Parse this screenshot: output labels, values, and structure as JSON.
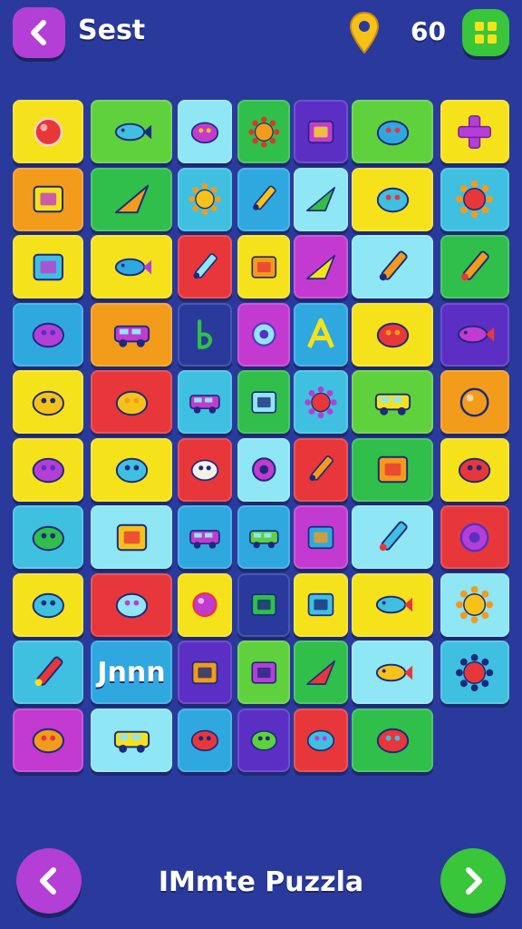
{
  "header": {
    "title": "Sest",
    "score": "60",
    "back_icon": "chevron-left-icon",
    "coin_icon": "location-pin-icon",
    "grid_icon": "grid-icon"
  },
  "footer": {
    "title": "IMmte Puzzla",
    "prev_icon": "chevron-left-icon",
    "next_icon": "chevron-right-icon"
  },
  "colors": {
    "background": "#2a3a9c",
    "purple": "#b43fd6",
    "green": "#39c63a",
    "yellow": "#f6e21a"
  },
  "tiles": [
    {
      "icon": "red-ball-icon",
      "bg": "#f6e21a",
      "c1": "#e8373a",
      "c2": "#ffd2d2"
    },
    {
      "icon": "fish-icon",
      "bg": "#5fd13c",
      "c1": "#3fc0e0",
      "c2": "#1b2a7c"
    },
    {
      "icon": "burger-icon",
      "bg": "#8fe6f5",
      "c1": "#c33ad0",
      "c2": "#f6c21a"
    },
    {
      "icon": "gear-icon",
      "bg": "#2fbf4a",
      "c1": "#f39b1a",
      "c2": "#d83a2a"
    },
    {
      "icon": "robot-icon",
      "bg": "#5b2fc4",
      "c1": "#c33ad0",
      "c2": "#f6e21a"
    },
    {
      "icon": "toy-blocks-icon",
      "bg": "#5fd13c",
      "c1": "#2fa8e0",
      "c2": "#e8373a"
    },
    {
      "icon": "plus-icon",
      "bg": "#f6e21a",
      "c1": "#b43fd6",
      "c2": "#7a1fa0"
    },
    {
      "icon": "bucket-icon",
      "bg": "#f39b1a",
      "c1": "#f6e21a",
      "c2": "#c33ad0"
    },
    {
      "icon": "triangle-ruler-icon",
      "bg": "#2fbf4a",
      "c1": "#f39b1a",
      "c2": "#1b2a7c"
    },
    {
      "icon": "sun-icon",
      "bg": "#3fc0e0",
      "c1": "#f6c21a",
      "c2": "#f39b1a"
    },
    {
      "icon": "pencil-icon",
      "bg": "#2fa8e0",
      "c1": "#f6c21a",
      "c2": "#1b2a7c"
    },
    {
      "icon": "flag-icon",
      "bg": "#8fe6f5",
      "c1": "#2fbf4a",
      "c2": "#e8373a"
    },
    {
      "icon": "cloud-icon",
      "bg": "#f6e21a",
      "c1": "#3fc0e0",
      "c2": "#e8373a"
    },
    {
      "icon": "flower-icon",
      "bg": "#3fc0e0",
      "c1": "#e8373a",
      "c2": "#f39b1a"
    },
    {
      "icon": "box-icon",
      "bg": "#f6e21a",
      "c1": "#3fc0e0",
      "c2": "#c33ad0"
    },
    {
      "icon": "fish-toy-icon",
      "bg": "#f6e21a",
      "c1": "#2fa8e0",
      "c2": "#b43fd6"
    },
    {
      "icon": "screwdriver-icon",
      "bg": "#e8373a",
      "c1": "#8fe6f5",
      "c2": "#1b2a7c"
    },
    {
      "icon": "cup-icon",
      "bg": "#f6e21a",
      "c1": "#f39b1a",
      "c2": "#e8373a"
    },
    {
      "icon": "paper-plane-icon",
      "bg": "#c33ad0",
      "c1": "#f6e21a",
      "c2": "#f39b1a"
    },
    {
      "icon": "scissors-icon",
      "bg": "#8fe6f5",
      "c1": "#f39b1a",
      "c2": "#1b2a7c"
    },
    {
      "icon": "paintbrush-icon",
      "bg": "#2fbf4a",
      "c1": "#f39b1a",
      "c2": "#e8373a"
    },
    {
      "icon": "octopus-icon",
      "bg": "#2fa8e0",
      "c1": "#b43fd6",
      "c2": "#5b2fc4"
    },
    {
      "icon": "car-icon",
      "bg": "#f39b1a",
      "c1": "#c33ad0",
      "c2": "#1b2a7c"
    },
    {
      "icon": "letter-b-icon",
      "bg": "#2a3a9c",
      "c1": "#2fbf4a",
      "c2": "#1b2a7c"
    },
    {
      "icon": "ring-icon",
      "bg": "#c33ad0",
      "c1": "#8fe6f5",
      "c2": "#5b2fc4"
    },
    {
      "icon": "letter-a-icon",
      "bg": "#2fa8e0",
      "c1": "#f6e21a",
      "c2": "#1b2a7c"
    },
    {
      "icon": "sausage-icon",
      "bg": "#f6e21a",
      "c1": "#e8373a",
      "c2": "#f39b1a"
    },
    {
      "icon": "bird-icon",
      "bg": "#5b2fc4",
      "c1": "#c33ad0",
      "c2": "#e8373a"
    },
    {
      "icon": "banana-icon",
      "bg": "#f6e21a",
      "c1": "#f6c21a",
      "c2": "#1b2a7c"
    },
    {
      "icon": "cat-icon",
      "bg": "#e8373a",
      "c1": "#f6c21a",
      "c2": "#f39b1a"
    },
    {
      "icon": "van-icon",
      "bg": "#3fc0e0",
      "c1": "#c33ad0",
      "c2": "#1b2a7c"
    },
    {
      "icon": "phone-icon",
      "bg": "#2fbf4a",
      "c1": "#8fe6f5",
      "c2": "#1b2a7c"
    },
    {
      "icon": "virus-icon",
      "bg": "#3fc0e0",
      "c1": "#e8373a",
      "c2": "#b43fd6"
    },
    {
      "icon": "truck-icon",
      "bg": "#5fd13c",
      "c1": "#f6e21a",
      "c2": "#e8373a"
    },
    {
      "icon": "orange-icon",
      "bg": "#f39b1a",
      "c1": "#f39b1a",
      "c2": "#1b2a7c"
    },
    {
      "icon": "guitar-icon",
      "bg": "#f6e21a",
      "c1": "#b43fd6",
      "c2": "#5b2fc4"
    },
    {
      "icon": "whistle-icon",
      "bg": "#f6e21a",
      "c1": "#3fc0e0",
      "c2": "#1b2a7c"
    },
    {
      "icon": "no-sign-icon",
      "bg": "#e8373a",
      "c1": "#f5f0e6",
      "c2": "#1b2a7c"
    },
    {
      "icon": "magnifier-icon",
      "bg": "#8fe6f5",
      "c1": "#c33ad0",
      "c2": "#1b2a7c"
    },
    {
      "icon": "match-icon",
      "bg": "#e8373a",
      "c1": "#f39b1a",
      "c2": "#1b2a7c"
    },
    {
      "icon": "envelope-icon",
      "bg": "#2fbf4a",
      "c1": "#f39b1a",
      "c2": "#e8373a"
    },
    {
      "icon": "monkey-face-icon",
      "bg": "#f6e21a",
      "c1": "#e8373a",
      "c2": "#1b2a7c"
    },
    {
      "icon": "turtle-icon",
      "bg": "#3fc0e0",
      "c1": "#2fbf4a",
      "c2": "#1b2a7c"
    },
    {
      "icon": "picture-frame-icon",
      "bg": "#8fe6f5",
      "c1": "#f6c21a",
      "c2": "#e8373a"
    },
    {
      "icon": "bus-icon",
      "bg": "#2fa8e0",
      "c1": "#c33ad0",
      "c2": "#1b2a7c"
    },
    {
      "icon": "wagon-icon",
      "bg": "#2fa8e0",
      "c1": "#5fd13c",
      "c2": "#f39b1a"
    },
    {
      "icon": "photo-icon",
      "bg": "#c33ad0",
      "c1": "#2fa8e0",
      "c2": "#f39b1a"
    },
    {
      "icon": "hammer-icon",
      "bg": "#8fe6f5",
      "c1": "#3fc0e0",
      "c2": "#e8373a"
    },
    {
      "icon": "donut-icon",
      "bg": "#e8373a",
      "c1": "#b43fd6",
      "c2": "#5b2fc4"
    },
    {
      "icon": "leaf-icon",
      "bg": "#f6e21a",
      "c1": "#3fc0e0",
      "c2": "#1b2a7c"
    },
    {
      "icon": "pillow-icon",
      "bg": "#e8373a",
      "c1": "#8fe6f5",
      "c2": "#c33ad0"
    },
    {
      "icon": "ball-icon",
      "bg": "#f6e21a",
      "c1": "#c33ad0",
      "c2": "#e8373a"
    },
    {
      "icon": "crate-icon",
      "bg": "#2a3a9c",
      "c1": "#2fbf4a",
      "c2": "#1b2a7c"
    },
    {
      "icon": "dice-icon",
      "bg": "#f6e21a",
      "c1": "#3fc0e0",
      "c2": "#1b2a7c"
    },
    {
      "icon": "fish-red-icon",
      "bg": "#f6e21a",
      "c1": "#3fc0e0",
      "c2": "#e8373a"
    },
    {
      "icon": "sun-bright-icon",
      "bg": "#8fe6f5",
      "c1": "#f6c21a",
      "c2": "#f39b1a"
    },
    {
      "icon": "rocket-icon",
      "bg": "#3fc0e0",
      "c1": "#e8373a",
      "c2": "#f6e21a"
    },
    {
      "icon": "text-tile",
      "bg": "#2fa8e0",
      "c1": "#1b2a7c",
      "c2": "#ffffff",
      "label": "Jnnn"
    },
    {
      "icon": "toaster-icon",
      "bg": "#5b2fc4",
      "c1": "#f39b1a",
      "c2": "#1b2a7c"
    },
    {
      "icon": "cube-icon",
      "bg": "#5fd13c",
      "c1": "#b43fd6",
      "c2": "#1b2a7c"
    },
    {
      "icon": "arrow-bolt-icon",
      "bg": "#2fbf4a",
      "c1": "#e8373a",
      "c2": "#1b2a7c"
    },
    {
      "icon": "dragon-icon",
      "bg": "#8fe6f5",
      "c1": "#f6c21a",
      "c2": "#e8373a"
    },
    {
      "icon": "monster-icon",
      "bg": "#3fc0e0",
      "c1": "#e8373a",
      "c2": "#1b2a7c"
    },
    {
      "icon": "tulip-icon",
      "bg": "#c33ad0",
      "c1": "#f39b1a",
      "c2": "#e8373a"
    },
    {
      "icon": "school-bus-icon",
      "bg": "#8fe6f5",
      "c1": "#f6e21a",
      "c2": "#1b2a7c"
    },
    {
      "icon": "mask-icon",
      "bg": "#2fa8e0",
      "c1": "#e8373a",
      "c2": "#1b2a7c"
    },
    {
      "icon": "capsule-icon",
      "bg": "#5b2fc4",
      "c1": "#5fd13c",
      "c2": "#1b2a7c"
    },
    {
      "icon": "bottles-icon",
      "bg": "#e8373a",
      "c1": "#3fc0e0",
      "c2": "#b43fd6"
    },
    {
      "icon": "plant-icon",
      "bg": "#2fbf4a",
      "c1": "#e8373a",
      "c2": "#3fc0e0"
    }
  ]
}
